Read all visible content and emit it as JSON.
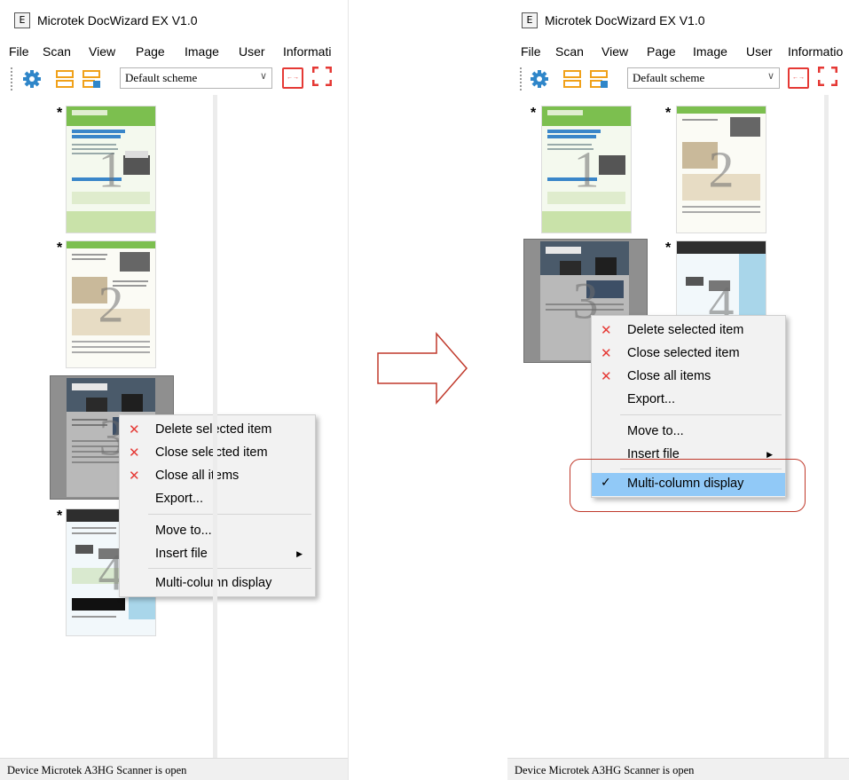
{
  "app": {
    "title": "Microtek DocWizard EX V1.0",
    "icon_letter": "E"
  },
  "menubar": {
    "left_items": [
      "File",
      "Scan",
      "View",
      "Page",
      "Image",
      "User",
      "Informati"
    ],
    "right_items": [
      "File",
      "Scan",
      "View",
      "Page",
      "Image",
      "User",
      "Informatio"
    ]
  },
  "toolbar": {
    "scheme_value": "Default scheme",
    "icons": [
      "gear-icon",
      "multi-page-icon",
      "page-settings-icon",
      "fit-width-icon",
      "fullscreen-icon"
    ]
  },
  "thumbnails": [
    {
      "number": "1",
      "marker": "*"
    },
    {
      "number": "2",
      "marker": "*"
    },
    {
      "number": "3",
      "marker": "*",
      "selected": true
    },
    {
      "number": "4",
      "marker": "*"
    }
  ],
  "context_menu": {
    "items": [
      {
        "label": "Delete selected item",
        "icon": "x-icon"
      },
      {
        "label": "Close selected item",
        "icon": "x-icon"
      },
      {
        "label": "Close all items",
        "icon": "x-icon"
      },
      {
        "label": "Export..."
      },
      {
        "label": "Move to..."
      },
      {
        "label": "Insert file",
        "submenu": true
      },
      {
        "label": "Multi-column display"
      }
    ],
    "checked_after": "Multi-column display"
  },
  "statusbar": {
    "text": "Device Microtek A3HG Scanner is open"
  },
  "colors": {
    "accent_red": "#e53935",
    "callout_red": "#c0392b",
    "highlight_blue": "#91c9f7",
    "arrow_red": "#c0392b"
  }
}
